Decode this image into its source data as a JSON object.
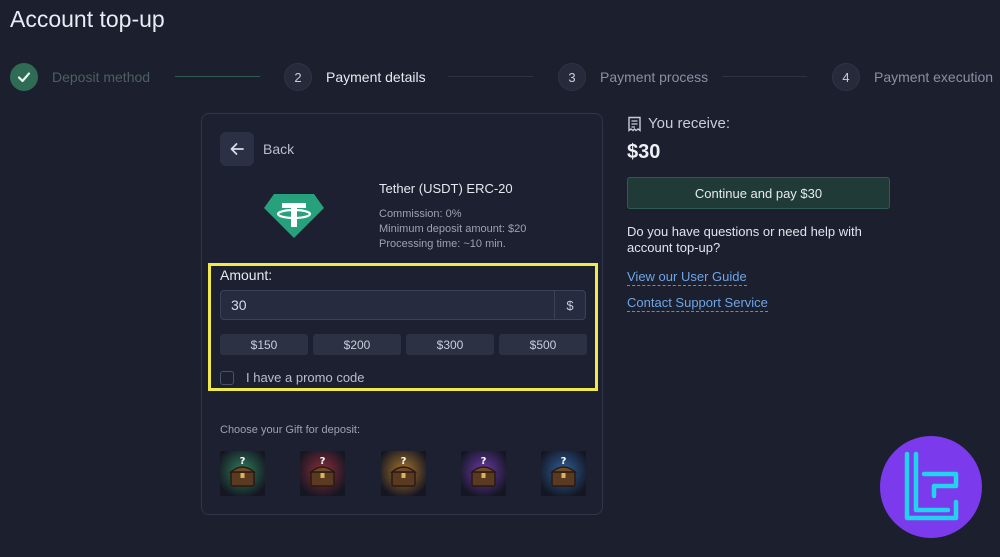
{
  "page": {
    "title": "Account top-up"
  },
  "stepper": {
    "steps": [
      {
        "number": "",
        "label": "Deposit method",
        "state": "done"
      },
      {
        "number": "2",
        "label": "Payment details",
        "state": "active"
      },
      {
        "number": "3",
        "label": "Payment process",
        "state": "pending"
      },
      {
        "number": "4",
        "label": "Payment execution",
        "state": "pending"
      }
    ]
  },
  "card": {
    "back_label": "Back",
    "method": {
      "name": "Tether (USDT) ERC-20",
      "commission": "Commission: 0%",
      "minimum": "Minimum deposit amount: $20",
      "processing": "Processing time: ~10 min.",
      "icon": "tether-icon"
    },
    "amount": {
      "label": "Amount:",
      "value": "30",
      "currency": "$",
      "presets": [
        "$150",
        "$200",
        "$300",
        "$500"
      ]
    },
    "promo_label": "I have a promo code",
    "gift_label": "Choose your Gift for deposit:",
    "gifts": [
      {
        "color": "#2f7d5b"
      },
      {
        "color": "#8a2e3a"
      },
      {
        "color": "#a8742a"
      },
      {
        "color": "#6a3aa8"
      },
      {
        "color": "#2e5f9a"
      }
    ]
  },
  "summary": {
    "receive_label": "You receive:",
    "receive_amount": "$30",
    "pay_button": "Continue and pay $30",
    "help_text": "Do you have questions or need help with account top-up?",
    "links": [
      "View our User Guide",
      "Contact Support Service"
    ]
  },
  "colors": {
    "background": "#1c1f2e",
    "accent_green": "#2f6b55",
    "link": "#6ea5e6",
    "highlight": "#f2e94a",
    "brand": "#7c3aed"
  }
}
